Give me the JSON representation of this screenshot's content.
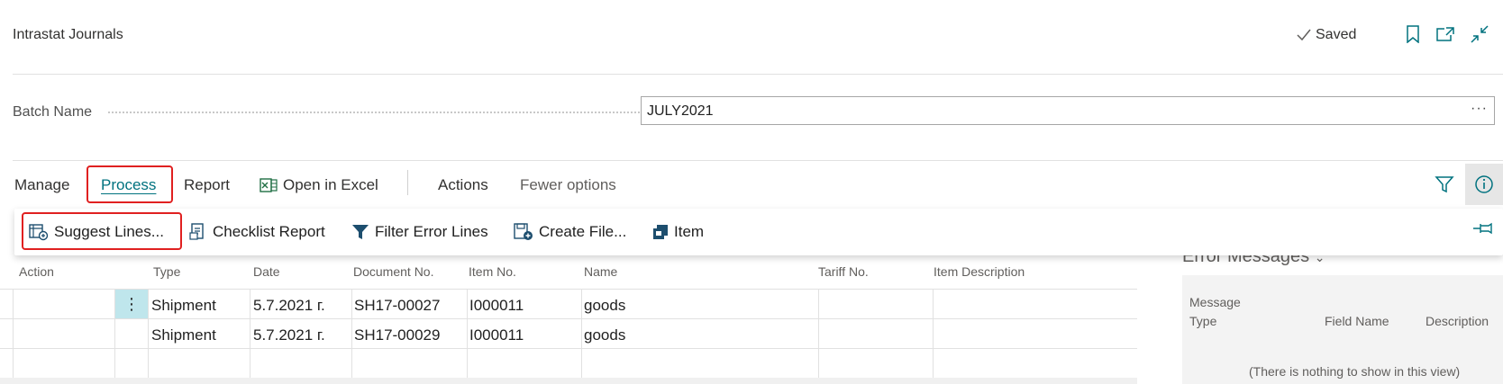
{
  "header": {
    "title": "Intrastat Journals",
    "saved_label": "Saved",
    "icons": [
      "checkmark-icon",
      "bookmark-icon",
      "open-new-window-icon",
      "collapse-icon"
    ]
  },
  "batch": {
    "label": "Batch Name",
    "value": "JULY2021",
    "more": "···"
  },
  "actionbar": {
    "manage": "Manage",
    "process": "Process",
    "report": "Report",
    "open_in_excel": "Open in Excel",
    "actions": "Actions",
    "fewer_options": "Fewer options"
  },
  "submenu": {
    "suggest_lines": "Suggest Lines...",
    "checklist_report": "Checklist Report",
    "filter_error_lines": "Filter Error Lines",
    "create_file": "Create File...",
    "item": "Item"
  },
  "table": {
    "columns": [
      "Action",
      "Type",
      "Date",
      "Document No.",
      "Item No.",
      "Name",
      "Tariff No.",
      "Item Description"
    ],
    "rows": [
      {
        "type": "Shipment",
        "date": "5.7.2021 г.",
        "document_no": "SH17-00027",
        "item_no": "I000011",
        "name": "goods",
        "tariff_no": "",
        "item_description": ""
      },
      {
        "type": "Shipment",
        "date": "5.7.2021 г.",
        "document_no": "SH17-00029",
        "item_no": "I000011",
        "name": "goods",
        "tariff_no": "",
        "item_description": ""
      }
    ],
    "row_menu": "⋮"
  },
  "error_panel": {
    "title": "Error Messages",
    "col_message_type_1": "Message",
    "col_message_type_2": "Type",
    "col_field_name": "Field Name",
    "col_description": "Description",
    "empty": "(There is nothing to show in this view)"
  },
  "colors": {
    "accent": "#00727f",
    "highlight_border": "#e02020",
    "selected_row_handle": "#bfe6ec"
  }
}
